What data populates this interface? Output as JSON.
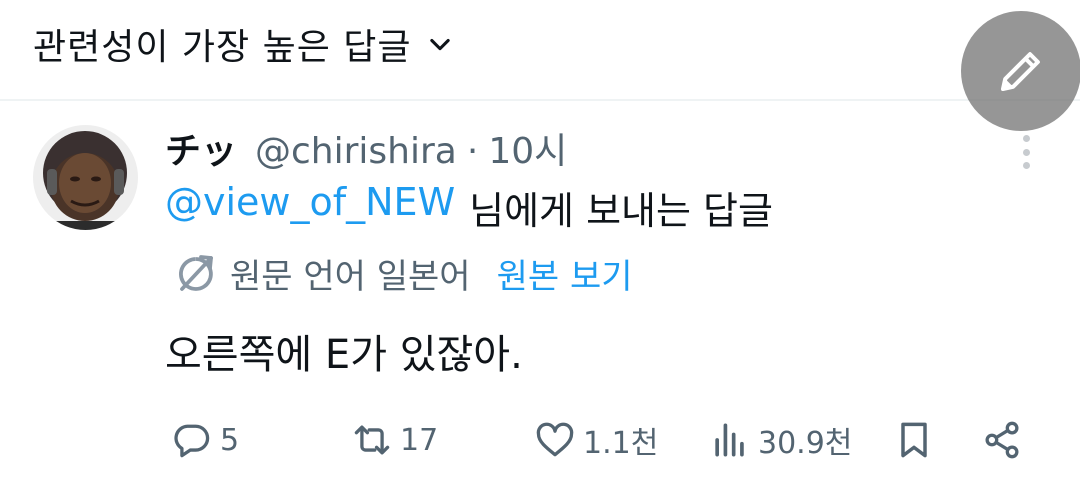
{
  "header": {
    "sort_label": "관련성이 가장 높은 답글"
  },
  "tweet": {
    "display_name": "チッ",
    "handle": "@chirishira",
    "separator": "·",
    "time": "10시",
    "mention": "@view_of_NEW",
    "reply_to_rest": "님에게 보내는 답글",
    "translate_info": "원문 언어 일본어",
    "translate_link": "원본 보기",
    "text": "오른쪽에 E가 있잖아."
  },
  "actions": {
    "replies": "5",
    "retweets": "17",
    "likes": "1.1천",
    "views": "30.9천"
  },
  "colors": {
    "accent": "#1d9bf0",
    "secondary_text": "#536471",
    "primary_text": "#0f1419",
    "fab": "#8a8a8a"
  },
  "icons": [
    "chevron-down-icon",
    "pencil-icon",
    "more-vertical-icon",
    "translate-icon",
    "reply-icon",
    "retweet-icon",
    "like-icon",
    "views-icon",
    "bookmark-icon",
    "share-icon"
  ]
}
